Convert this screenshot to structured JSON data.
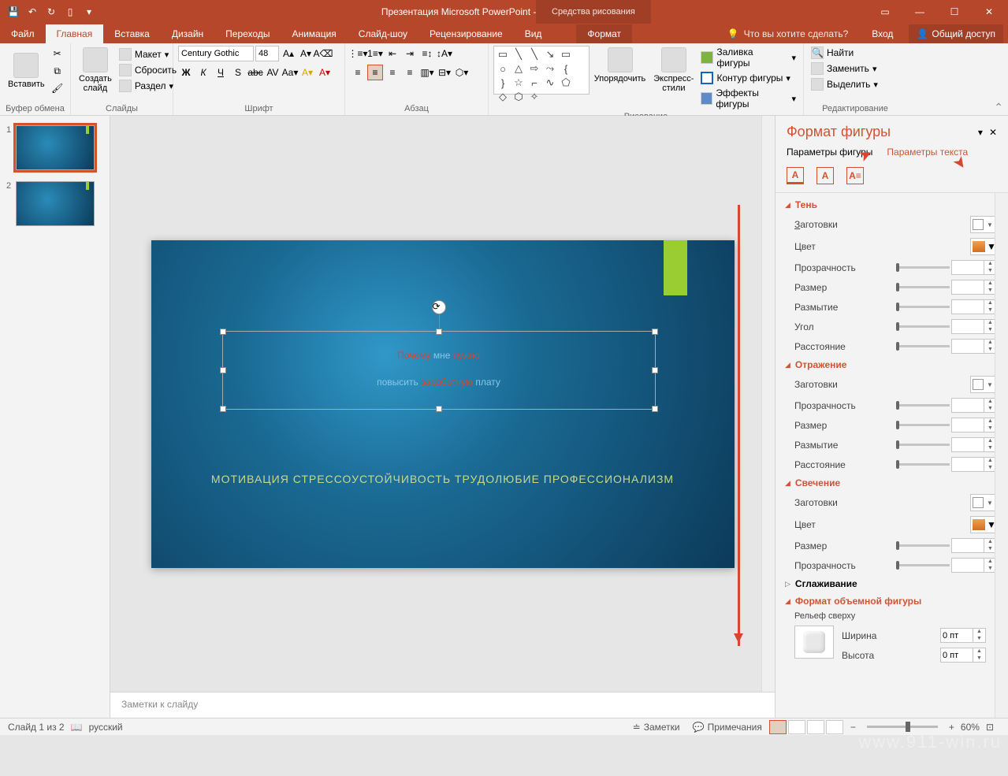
{
  "title": "Презентация Microsoft PowerPoint - PowerPoint",
  "contextTab": "Средства рисования",
  "tabs": {
    "file": "Файл",
    "home": "Главная",
    "insert": "Вставка",
    "design": "Дизайн",
    "transitions": "Переходы",
    "animations": "Анимация",
    "slideshow": "Слайд-шоу",
    "review": "Рецензирование",
    "view": "Вид",
    "format": "Формат"
  },
  "tellme": "Что вы хотите сделать?",
  "signin": "Вход",
  "share": "Общий доступ",
  "ribbon": {
    "clipboard": {
      "paste": "Вставить",
      "label": "Буфер обмена"
    },
    "slides": {
      "new": "Создать\nслайд",
      "layout": "Макет",
      "reset": "Сбросить",
      "section": "Раздел",
      "label": "Слайды"
    },
    "font": {
      "name": "Century Gothic",
      "size": "48",
      "label": "Шрифт"
    },
    "paragraph": {
      "label": "Абзац"
    },
    "drawing": {
      "arrange": "Упорядочить",
      "styles": "Экспресс-\nстили",
      "fill": "Заливка фигуры",
      "outline": "Контур фигуры",
      "effects": "Эффекты фигуры",
      "label": "Рисование"
    },
    "editing": {
      "find": "Найти",
      "replace": "Заменить",
      "select": "Выделить",
      "label": "Редактирование"
    }
  },
  "slide": {
    "l1_r1": "Почему ",
    "l1_b1": "мне ",
    "l1_r2": "нужно",
    "l2_b1": "повысить ",
    "l2_r1": "заработную ",
    "l2_b2": "плату",
    "sub": "МОТИВАЦИЯ СТРЕССОУСТОЙЧИВОСТЬ ТРУДОЛЮБИЕ ПРОФЕССИОНАЛИЗМ"
  },
  "notes": "Заметки к слайду",
  "pane": {
    "title": "Формат фигуры",
    "tab1": "Параметры фигуры",
    "tab2": "Параметры текста",
    "shadow": "Тень",
    "reflection": "Отражение",
    "glow": "Свечение",
    "soft": "Сглаживание",
    "format3d": "Формат объемной фигуры",
    "presets": "Заготовки",
    "color": "Цвет",
    "transparency": "Прозрачность",
    "size": "Размер",
    "blur": "Размытие",
    "angle": "Угол",
    "distance": "Расстояние",
    "topbevel": "Рельеф сверху",
    "width": "Ширина",
    "height": "Высота",
    "pt": "0 пт"
  },
  "status": {
    "slide": "Слайд 1 из 2",
    "lang": "русский",
    "notes": "Заметки",
    "comments": "Примечания",
    "zoom": "60%"
  },
  "thumbs": [
    "1",
    "2"
  ],
  "watermark": "www.911-win.ru"
}
